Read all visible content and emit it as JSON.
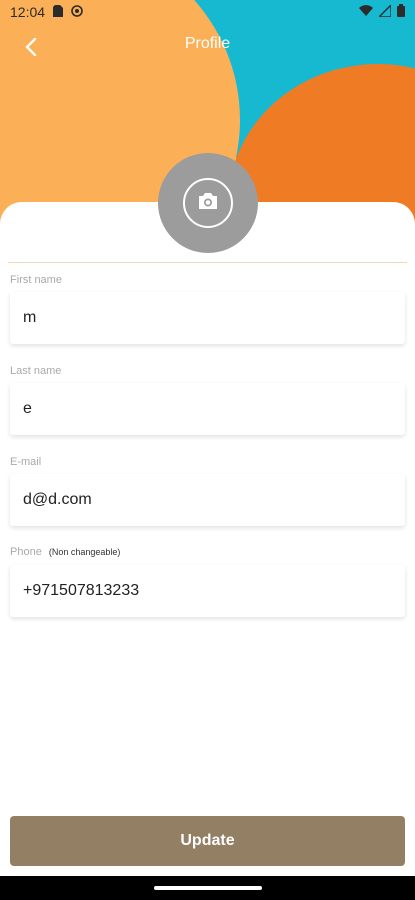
{
  "status_bar": {
    "time": "12:04",
    "icons_left": [
      "sim-icon",
      "shield-icon"
    ],
    "icons_right": [
      "wifi-icon",
      "signal-icon",
      "battery-icon"
    ]
  },
  "header": {
    "title": "Profile",
    "colors": {
      "yellow": "#fbb057",
      "blue": "#17b9d0",
      "orange": "#ef7b25"
    }
  },
  "avatar": {
    "icon": "camera-icon"
  },
  "form": {
    "first_name": {
      "label": "First name",
      "value": "m"
    },
    "last_name": {
      "label": "Last name",
      "value": "e"
    },
    "email": {
      "label": "E-mail",
      "value": "d@d.com"
    },
    "phone": {
      "label": "Phone",
      "note": "(Non changeable)",
      "value": "+971507813233"
    }
  },
  "actions": {
    "update_label": "Update",
    "button_color": "#927f64"
  }
}
